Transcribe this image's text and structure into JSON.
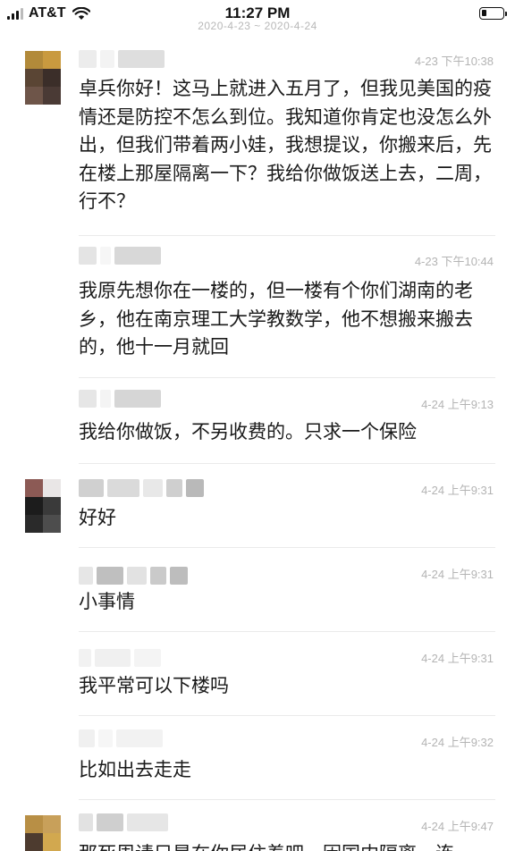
{
  "status_bar": {
    "carrier": "AT&T",
    "time": "11:27 PM",
    "battery_level": 0.25,
    "icons": [
      "signal-icon",
      "wifi-icon",
      "battery-icon"
    ]
  },
  "date_range": "2020-4-23 ~ 2020-4-24",
  "messages": [
    {
      "timestamp": "4-23 下午10:38",
      "text": "卓兵你好！这马上就进入五月了，但我见美国的疫情还是防控不怎么到位。我知道你肯定也没怎么外出，但我们带着两小娃，我想提议，你搬来后，先在楼上那屋隔离一下？我给你做饭送上去，二周，行不？"
    },
    {
      "timestamp": "4-23 下午10:44",
      "text": "我原先想你在一楼的，但一楼有个你们湖南的老乡，他在南京理工大学教数学，他不想搬来搬去的，他十一月就回"
    },
    {
      "timestamp": "4-24 上午9:13",
      "text": "我给你做饭，不另收费的。只求一个保险"
    },
    {
      "timestamp": "4-24 上午9:31",
      "text": "好好"
    },
    {
      "timestamp": "4-24 上午9:31",
      "text": "小事情"
    },
    {
      "timestamp": "4-24 上午9:31",
      "text": "我平常可以下楼吗"
    },
    {
      "timestamp": "4-24 上午9:32",
      "text": "比如出去走走"
    },
    {
      "timestamp": "4-24 上午9:47",
      "text": "那死周请只是在你居住着吧，因国内隔离，连"
    }
  ]
}
